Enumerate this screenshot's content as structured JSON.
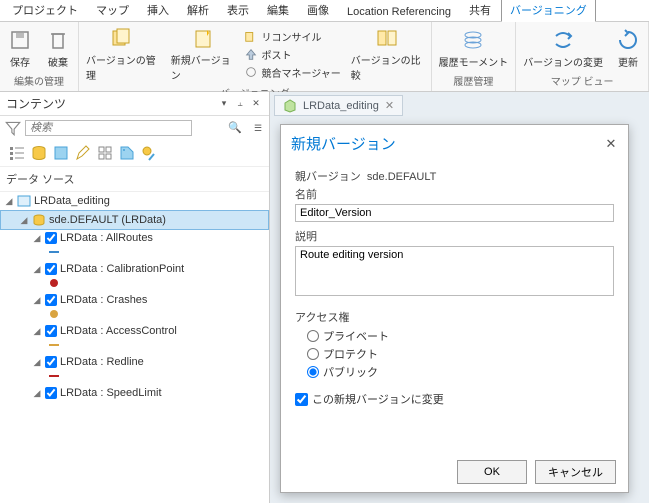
{
  "tabs": [
    "プロジェクト",
    "マップ",
    "挿入",
    "解析",
    "表示",
    "編集",
    "画像",
    "Location Referencing",
    "共有",
    "バージョニング"
  ],
  "activeTab": 9,
  "ribbon": {
    "g1": {
      "label": "編集の管理",
      "save": "保存",
      "discard": "破棄"
    },
    "g2": {
      "label": "バージョニング",
      "manage": "バージョンの管理",
      "new": "新規バージョン",
      "reconcile": "リコンサイル",
      "post": "ポスト",
      "conflict": "競合マネージャー",
      "compare": "バージョンの比較"
    },
    "g3": {
      "label": "履歴管理",
      "moment": "履歴モーメント"
    },
    "g4": {
      "label": "マップ ビュー",
      "change": "バージョンの変更",
      "refresh": "更新"
    }
  },
  "contents": {
    "title": "コンテンツ",
    "searchPlaceholder": "検索",
    "sourceHead": "データ ソース",
    "root": "LRData_editing",
    "selected": "sde.DEFAULT (LRData)",
    "layers": [
      "LRData : AllRoutes",
      "LRData : CalibrationPoint",
      "LRData : Crashes",
      "LRData : AccessControl",
      "LRData : Redline",
      "LRData : SpeedLimit"
    ]
  },
  "docTab": "LRData_editing",
  "dialog": {
    "title": "新規バージョン",
    "parentLabel": "親バージョン",
    "parentValue": "sde.DEFAULT",
    "nameLabel": "名前",
    "nameValue": "Editor_Version",
    "descLabel": "説明",
    "descValue": "Route editing version",
    "accessLabel": "アクセス権",
    "private": "プライベート",
    "protected": "プロテクト",
    "public": "パブリック",
    "changeTo": "この新規バージョンに変更",
    "ok": "OK",
    "cancel": "キャンセル"
  }
}
